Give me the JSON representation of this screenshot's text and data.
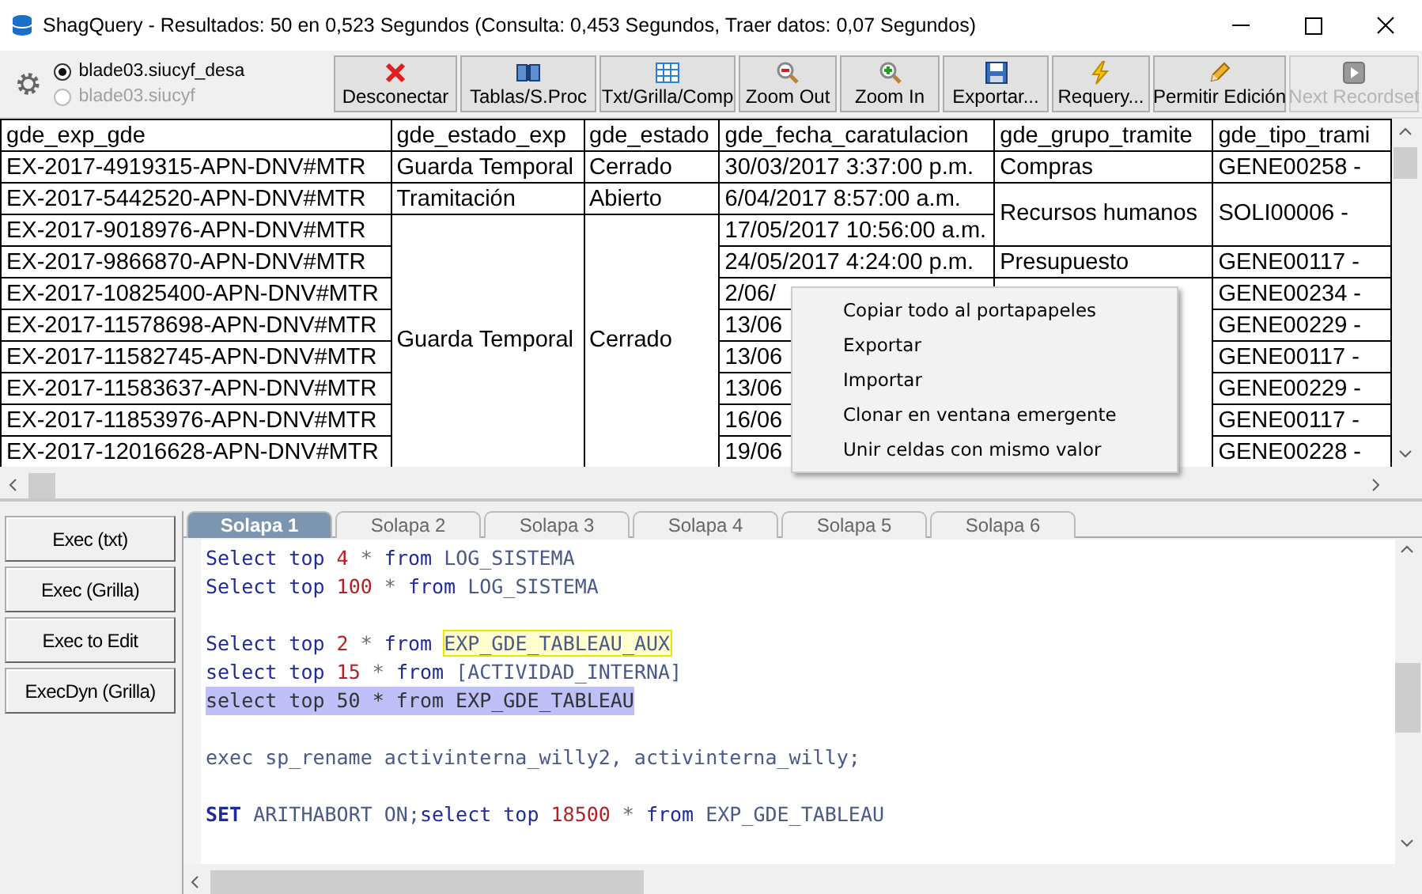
{
  "window": {
    "title": "ShagQuery - Resultados: 50 en 0,523 Segundos (Consulta: 0,453 Segundos, Traer datos: 0,07 Segundos)"
  },
  "connections": [
    {
      "label": "blade03.siucyf_desa",
      "selected": true,
      "disabled": false
    },
    {
      "label": "blade03.siucyf",
      "selected": false,
      "disabled": true
    }
  ],
  "toolbar": [
    {
      "label": "Desconectar",
      "kind": "disconnect",
      "disabled": false
    },
    {
      "label": "Tablas/S.Proc",
      "kind": "book",
      "disabled": false
    },
    {
      "label": "Txt/Grilla/Comp",
      "kind": "grid",
      "disabled": false
    },
    {
      "label": "Zoom Out",
      "kind": "zoomout",
      "disabled": false
    },
    {
      "label": "Zoom In",
      "kind": "zoomin",
      "disabled": false
    },
    {
      "label": "Exportar...",
      "kind": "save",
      "disabled": false
    },
    {
      "label": "Requery...",
      "kind": "bolt",
      "disabled": false
    },
    {
      "label": "Permitir Edición",
      "kind": "pencil",
      "disabled": false
    },
    {
      "label": "Next Recordset",
      "kind": "play",
      "disabled": true
    }
  ],
  "grid": {
    "columns": [
      "gde_exp_gde",
      "gde_estado_exp",
      "gde_estado",
      "gde_fecha_caratulacion",
      "gde_grupo_tramite",
      "gde_tipo_trami"
    ],
    "rows": [
      [
        {
          "text": "EX-2017-4919315-APN-DNV#MTR"
        },
        {
          "text": "Guarda Temporal"
        },
        {
          "text": "Cerrado"
        },
        {
          "text": "30/03/2017 3:37:00 p.m."
        },
        {
          "text": "Compras"
        },
        {
          "text": "GENE00258 -"
        }
      ],
      [
        {
          "text": "EX-2017-5442520-APN-DNV#MTR"
        },
        {
          "text": "Tramitación"
        },
        {
          "text": "Abierto"
        },
        {
          "text": "6/04/2017 8:57:00 a.m."
        },
        {
          "text": "Recursos humanos"
        },
        {
          "text": "SOLI00006 -"
        }
      ],
      [
        {
          "text": "EX-2017-9018976-APN-DNV#MTR"
        },
        {
          "merged_down": true
        },
        {
          "merged_down": true
        },
        {
          "text": "17/05/2017 10:56:00 a.m."
        },
        {
          "merged_up": true
        },
        {
          "merged_up": true
        }
      ],
      [
        {
          "text": "EX-2017-9866870-APN-DNV#MTR"
        },
        {
          "merged_down": true
        },
        {
          "merged_down": true
        },
        {
          "text": "24/05/2017 4:24:00 p.m."
        },
        {
          "text": "Presupuesto"
        },
        {
          "text": "GENE00117 -"
        }
      ],
      [
        {
          "text": "EX-2017-10825400-APN-DNV#MTR"
        },
        {
          "merged_down": true
        },
        {
          "merged_down": true
        },
        {
          "text": "2/06/"
        },
        {},
        {
          "text": "GENE00234 -"
        }
      ],
      [
        {
          "text": "EX-2017-11578698-APN-DNV#MTR"
        },
        {
          "text": "Guarda Temporal"
        },
        {
          "text": "Cerrado"
        },
        {
          "text": "13/06"
        },
        {
          "merged_up": true
        },
        {
          "text": "GENE00229 -"
        }
      ],
      [
        {
          "text": "EX-2017-11582745-APN-DNV#MTR"
        },
        {
          "merged_up": true
        },
        {
          "merged_up": true
        },
        {
          "text": "13/06"
        },
        {
          "merged_up": true
        },
        {
          "text": "GENE00117 -"
        }
      ],
      [
        {
          "text": "EX-2017-11583637-APN-DNV#MTR"
        },
        {
          "merged_up": true
        },
        {
          "merged_up": true
        },
        {
          "text": "13/06"
        },
        {
          "merged_up": true
        },
        {
          "text": "GENE00229 -"
        }
      ],
      [
        {
          "text": "EX-2017-11853976-APN-DNV#MTR"
        },
        {
          "merged_up": true
        },
        {
          "merged_up": true
        },
        {
          "text": "16/06"
        },
        {
          "merged_up": true
        },
        {
          "text": "GENE00117 -"
        }
      ],
      [
        {
          "text": "EX-2017-12016628-APN-DNV#MTR"
        },
        {
          "merged_up": true
        },
        {
          "merged_up": true
        },
        {
          "text": "19/06"
        },
        {
          "merged_up": true
        },
        {
          "text": "GENE00228 -"
        }
      ]
    ]
  },
  "context_menu": [
    "Copiar todo al portapapeles",
    "Exportar",
    "Importar",
    "Clonar en ventana emergente",
    "Unir celdas con mismo valor"
  ],
  "exec_buttons": [
    "Exec (txt)",
    "Exec (Grilla)",
    "Exec to Edit",
    "ExecDyn (Grilla)"
  ],
  "tabs": [
    {
      "label": "Solapa 1",
      "selected": true
    },
    {
      "label": "Solapa 2",
      "selected": false
    },
    {
      "label": "Solapa 3",
      "selected": false
    },
    {
      "label": "Solapa 4",
      "selected": false
    },
    {
      "label": "Solapa 5",
      "selected": false
    },
    {
      "label": "Solapa 6",
      "selected": false
    }
  ],
  "editor": {
    "lines": [
      {
        "selected": false,
        "tokens": [
          {
            "text": "Select top ",
            "kind": "kw"
          },
          {
            "text": "4 ",
            "kind": "num"
          },
          {
            "text": "* ",
            "kind": "op"
          },
          {
            "text": "from ",
            "kind": "kw"
          },
          {
            "text": "LOG_SISTEMA",
            "kind": "id"
          }
        ]
      },
      {
        "selected": false,
        "tokens": [
          {
            "text": "Select top ",
            "kind": "kw"
          },
          {
            "text": "100 ",
            "kind": "num"
          },
          {
            "text": "* ",
            "kind": "op"
          },
          {
            "text": "from ",
            "kind": "kw"
          },
          {
            "text": "LOG_SISTEMA",
            "kind": "id"
          }
        ]
      },
      {
        "selected": false
      },
      {
        "selected": false,
        "tokens": [
          {
            "text": "Select top ",
            "kind": "kw"
          },
          {
            "text": "2 ",
            "kind": "num"
          },
          {
            "text": "* ",
            "kind": "op"
          },
          {
            "text": "from ",
            "kind": "kw"
          },
          {
            "text": "EXP_GDE_TABLEAU_AUX",
            "kind": "match"
          }
        ]
      },
      {
        "selected": false,
        "tokens": [
          {
            "text": "select top ",
            "kind": "kw"
          },
          {
            "text": "15 ",
            "kind": "num"
          },
          {
            "text": "* ",
            "kind": "op"
          },
          {
            "text": "from ",
            "kind": "kw"
          },
          {
            "text": "[ACTIVIDAD_INTERNA]",
            "kind": "id"
          }
        ]
      },
      {
        "selected": true,
        "tokens": [
          {
            "text": "select top 50 * from EXP_GDE_TABLEAU",
            "kind": "plain"
          }
        ]
      },
      {
        "selected": false
      },
      {
        "selected": false,
        "tokens": [
          {
            "text": "exec sp_rename activinterna_willy2, activinterna_willy;",
            "kind": "id"
          }
        ]
      },
      {
        "selected": false
      },
      {
        "selected": false,
        "tokens": [
          {
            "text": "SET ",
            "kind": "strong"
          },
          {
            "text": "ARITHABORT ON;",
            "kind": "id"
          },
          {
            "text": "select top ",
            "kind": "kw"
          },
          {
            "text": "18500 ",
            "kind": "num"
          },
          {
            "text": "* ",
            "kind": "op"
          },
          {
            "text": "from ",
            "kind": "kw"
          },
          {
            "text": "EXP_GDE_TABLEAU",
            "kind": "id"
          }
        ]
      }
    ]
  }
}
